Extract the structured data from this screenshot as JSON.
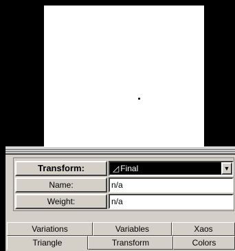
{
  "transform_panel": {
    "transform_label": "Transform:",
    "transform_value": "Final",
    "name_label": "Name:",
    "name_value": "n/a",
    "weight_label": "Weight:",
    "weight_value": "n/a"
  },
  "tabs": {
    "row1": [
      "Variations",
      "Variables",
      "Xaos"
    ],
    "row2": [
      "Triangle",
      "Transform",
      "Colors"
    ]
  }
}
